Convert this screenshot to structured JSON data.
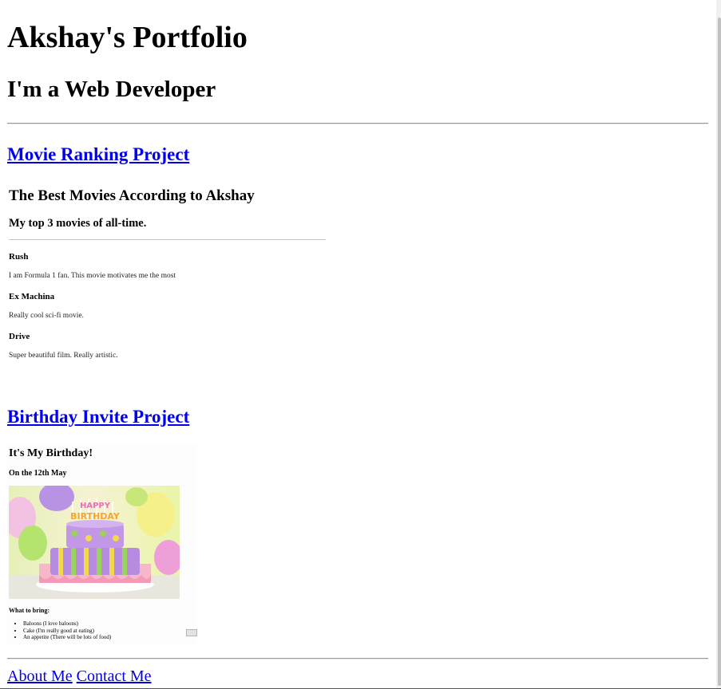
{
  "header": {
    "title": "Akshay's Portfolio",
    "subtitle": "I'm a Web Developer"
  },
  "projects": {
    "movie": {
      "link_label": "Movie Ranking Project",
      "preview": {
        "heading": "The Best Movies According to Akshay",
        "subheading": "My top 3 movies of all-time.",
        "movies": [
          {
            "title": "Rush",
            "description": "I am Formula 1 fan. This movie motivates me the most"
          },
          {
            "title": "Ex Machina",
            "description": "Really cool sci-fi movie."
          },
          {
            "title": "Drive",
            "description": "Super beautiful film. Really artistic."
          }
        ]
      }
    },
    "birthday": {
      "link_label": "Birthday Invite Project",
      "preview": {
        "heading": "It's My Birthday!",
        "date": "On the 12th May",
        "cake_text": "HAPPY BIRTHDAY",
        "bring_heading": "What to bring:",
        "bring_items": [
          "Baloons (I love baloons)",
          "Cake (I'm really good at eating)",
          "An appetite (There will be lots of food)"
        ]
      }
    }
  },
  "footer": {
    "about_label": "About Me",
    "contact_label": "Contact Me"
  },
  "colors": {
    "link": "#0000ee",
    "text": "#000000"
  }
}
